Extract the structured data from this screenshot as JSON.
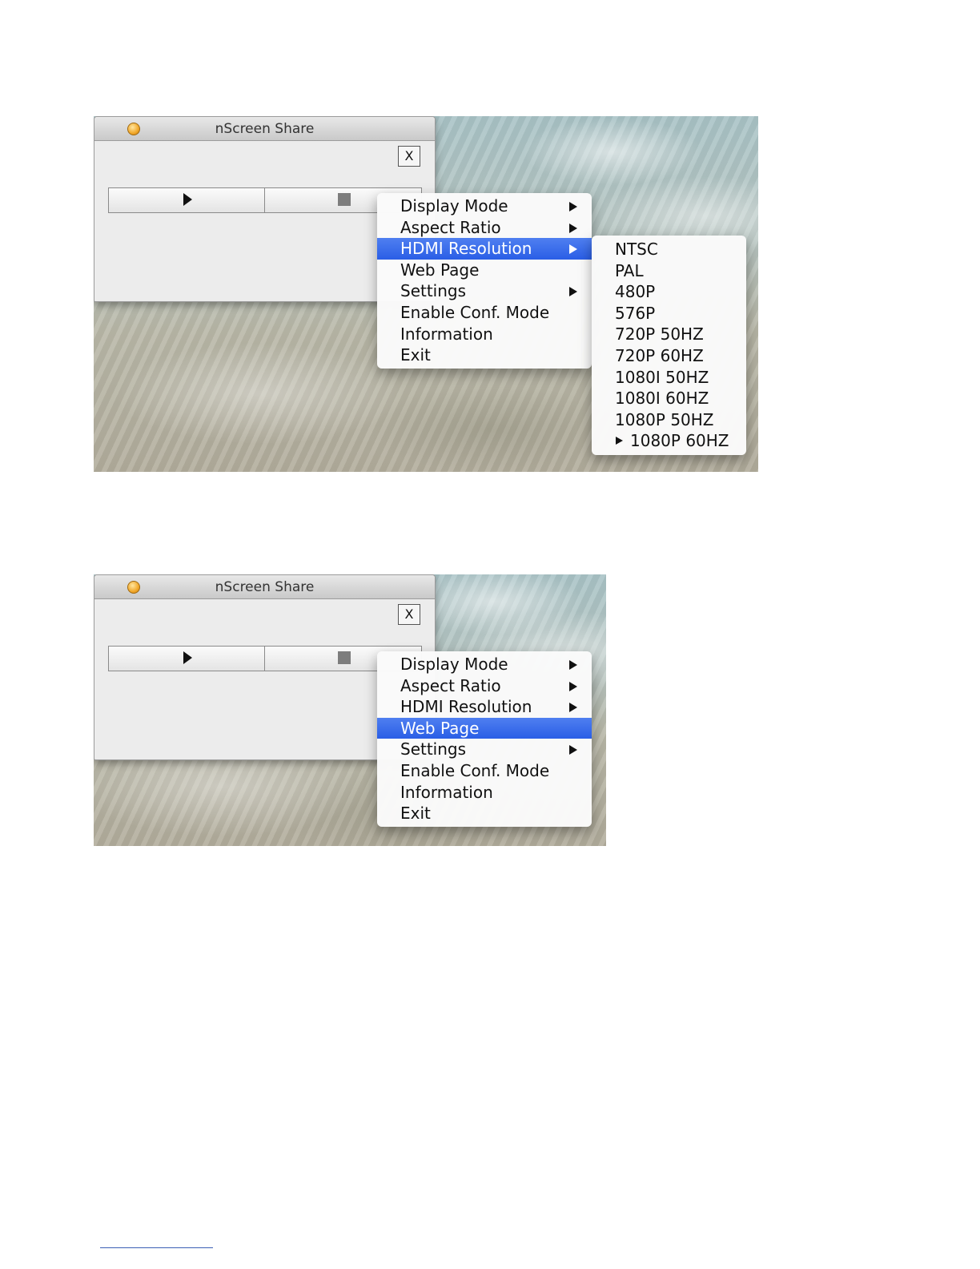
{
  "screenshots": [
    {
      "window": {
        "title": "nScreen Share",
        "close_label": "X"
      },
      "menu": [
        {
          "label": "Display Mode",
          "has_submenu": true,
          "selected": false
        },
        {
          "label": "Aspect Ratio",
          "has_submenu": true,
          "selected": false
        },
        {
          "label": "HDMI Resolution",
          "has_submenu": true,
          "selected": true
        },
        {
          "label": "Web Page",
          "has_submenu": false,
          "selected": false
        },
        {
          "label": "Settings",
          "has_submenu": true,
          "selected": false
        },
        {
          "label": "Enable Conf. Mode",
          "has_submenu": false,
          "selected": false
        },
        {
          "label": "Information",
          "has_submenu": false,
          "selected": false
        },
        {
          "label": "Exit",
          "has_submenu": false,
          "selected": false
        }
      ],
      "submenu": [
        {
          "label": "NTSC",
          "checked": false
        },
        {
          "label": "PAL",
          "checked": false
        },
        {
          "label": "480P",
          "checked": false
        },
        {
          "label": "576P",
          "checked": false
        },
        {
          "label": "720P 50HZ",
          "checked": false
        },
        {
          "label": "720P 60HZ",
          "checked": false
        },
        {
          "label": "1080I 50HZ",
          "checked": false
        },
        {
          "label": "1080I 60HZ",
          "checked": false
        },
        {
          "label": "1080P 50HZ",
          "checked": false
        },
        {
          "label": "1080P 60HZ",
          "checked": true
        }
      ]
    },
    {
      "window": {
        "title": "nScreen Share",
        "close_label": "X"
      },
      "menu": [
        {
          "label": "Display Mode",
          "has_submenu": true,
          "selected": false
        },
        {
          "label": "Aspect Ratio",
          "has_submenu": true,
          "selected": false
        },
        {
          "label": "HDMI Resolution",
          "has_submenu": true,
          "selected": false
        },
        {
          "label": "Web Page",
          "has_submenu": false,
          "selected": true
        },
        {
          "label": "Settings",
          "has_submenu": true,
          "selected": false
        },
        {
          "label": "Enable Conf. Mode",
          "has_submenu": false,
          "selected": false
        },
        {
          "label": "Information",
          "has_submenu": false,
          "selected": false
        },
        {
          "label": "Exit",
          "has_submenu": false,
          "selected": false
        }
      ]
    }
  ],
  "colors": {
    "selection": "#2f63e8",
    "accent_traffic_light": "#f1a82a"
  },
  "icons": {
    "play": "play-icon",
    "stop": "stop-icon",
    "submenu_arrow": "chevron-right-icon",
    "check": "check-triangle-icon"
  }
}
